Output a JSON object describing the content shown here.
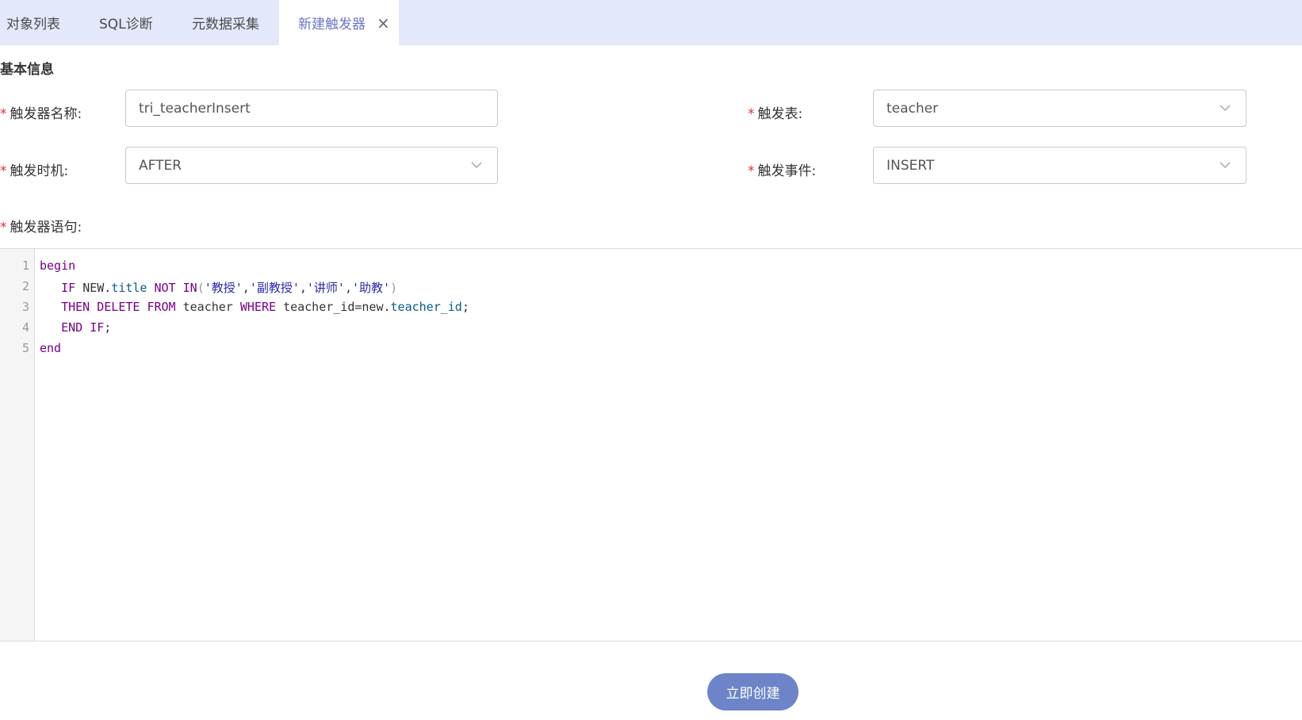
{
  "tabs": [
    {
      "label": "对象列表"
    },
    {
      "label": "SQL诊断"
    },
    {
      "label": "元数据采集"
    },
    {
      "label": "新建触发器",
      "active": true
    }
  ],
  "section_title": "基本信息",
  "form": {
    "required_mark": "*",
    "trigger_name": {
      "label": "触发器名称:",
      "value": "tri_teacherInsert"
    },
    "trigger_table": {
      "label": "触发表:",
      "value": "teacher"
    },
    "trigger_timing": {
      "label": "触发时机:",
      "value": "AFTER"
    },
    "trigger_event": {
      "label": "触发事件:",
      "value": "INSERT"
    },
    "trigger_statement": {
      "label": "触发器语句:"
    }
  },
  "editor": {
    "line_numbers": [
      "1",
      "2",
      "3",
      "4",
      "5"
    ],
    "lines": [
      "begin",
      "   IF NEW.title NOT IN('教授','副教授','讲师','助教')",
      "   THEN DELETE FROM teacher WHERE teacher_id=new.teacher_id;",
      "   END IF;",
      "end"
    ]
  },
  "submit_label": "立即创建",
  "colors": {
    "tabbar_bg": "#e4e8fb",
    "active_tab_text": "#6b77c6",
    "required": "#e0303a",
    "button_bg": "#6d84c8",
    "keyword": "#770088",
    "string": "#2a2aa6"
  }
}
